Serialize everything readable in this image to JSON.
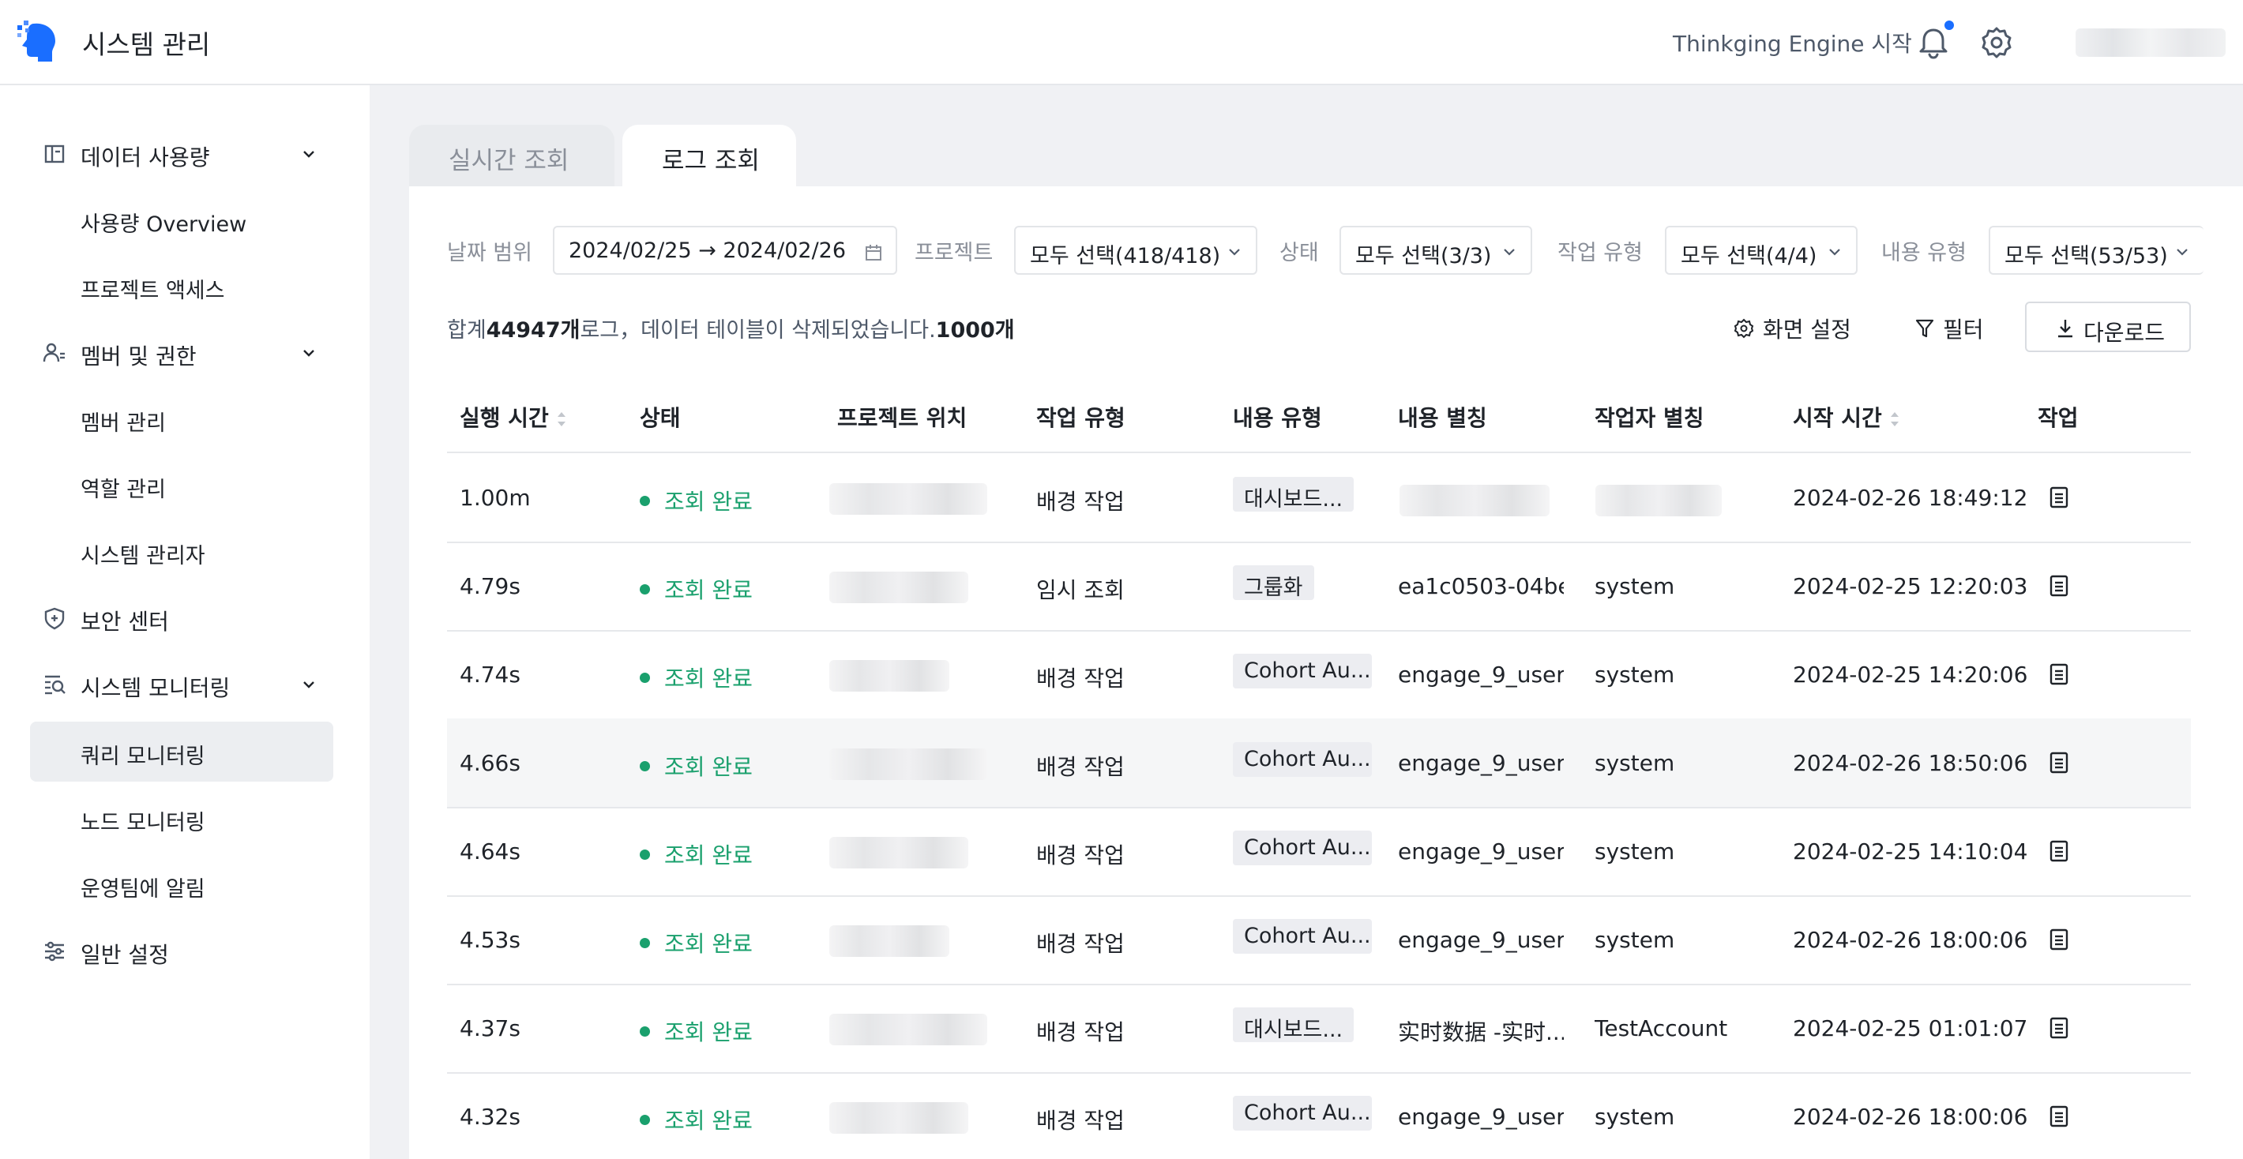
{
  "header": {
    "app_title": "시스템 관리",
    "engine_link": "Thinkging Engine 시작",
    "icons": [
      "logo-icon",
      "bell-icon",
      "gear-icon"
    ]
  },
  "sidebar": {
    "items": [
      {
        "label": "데이터 사용량",
        "icon": "chart-icon",
        "expandable": true
      },
      {
        "label": "사용량 Overview",
        "sub": true
      },
      {
        "label": "프로젝트 액세스",
        "sub": true
      },
      {
        "label": "멤버 및 권한",
        "icon": "members-icon",
        "expandable": true
      },
      {
        "label": "멤버 관리",
        "sub": true
      },
      {
        "label": "역할 관리",
        "sub": true
      },
      {
        "label": "시스템 관리자",
        "sub": true
      },
      {
        "label": "보안 센터",
        "icon": "shield-icon"
      },
      {
        "label": "시스템 모니터링",
        "icon": "monitor-icon",
        "expandable": true
      },
      {
        "label": "쿼리 모니터링",
        "sub": true,
        "active": true
      },
      {
        "label": "노드 모니터링",
        "sub": true
      },
      {
        "label": "운영팀에 알림",
        "sub": true
      },
      {
        "label": "일반 설정",
        "icon": "sliders-icon"
      }
    ]
  },
  "tabs": [
    {
      "label": "실시간 조회",
      "active": false
    },
    {
      "label": "로그 조회",
      "active": true
    }
  ],
  "filters": {
    "date_label": "날짜 범위",
    "date_value": "2024/02/25 → 2024/02/26",
    "project_label": "프로젝트",
    "project_value": "모두 선택(418/418)",
    "status_label": "상태",
    "status_value": "모두 선택(3/3)",
    "job_type_label": "작업 유형",
    "job_type_value": "모두 선택(4/4)",
    "content_type_label": "내용 유형",
    "content_type_value": "모두 선택(53/53)"
  },
  "summary": {
    "prefix": "합계",
    "total": "44947개",
    "middle": "로그，데이터 테이블이 삭제되었습니다.",
    "deleted": "1000개"
  },
  "toolbar": {
    "display_settings": "화면 설정",
    "filter": "필터",
    "download": "다운로드"
  },
  "table": {
    "columns": [
      "실행 시간",
      "상태",
      "프로젝트 위치",
      "작업 유형",
      "내용 유형",
      "내용 별칭",
      "작업자 별칭",
      "시작 시간",
      "작업"
    ],
    "rows": [
      {
        "duration": "1.00m",
        "status": "조회 완료",
        "job_type": "배경 작업",
        "content_type": "대시보드...",
        "alias": "",
        "operator": "",
        "start": "2024-02-26 18:49:12"
      },
      {
        "duration": "4.79s",
        "status": "조회 완료",
        "job_type": "임시 조회",
        "content_type": "그룹화",
        "alias": "ea1c0503-04be...",
        "operator": "system",
        "start": "2024-02-25 12:20:03"
      },
      {
        "duration": "4.74s",
        "status": "조회 완료",
        "job_type": "배경 작업",
        "content_type": "Cohort Au...",
        "alias": "engage_9_user...",
        "operator": "system",
        "start": "2024-02-25 14:20:06"
      },
      {
        "duration": "4.66s",
        "status": "조회 완료",
        "job_type": "배경 작업",
        "content_type": "Cohort Au...",
        "alias": "engage_9_user...",
        "operator": "system",
        "start": "2024-02-26 18:50:06"
      },
      {
        "duration": "4.64s",
        "status": "조회 완료",
        "job_type": "배경 작업",
        "content_type": "Cohort Au...",
        "alias": "engage_9_user...",
        "operator": "system",
        "start": "2024-02-25 14:10:04"
      },
      {
        "duration": "4.53s",
        "status": "조회 완료",
        "job_type": "배경 작업",
        "content_type": "Cohort Au...",
        "alias": "engage_9_user...",
        "operator": "system",
        "start": "2024-02-26 18:00:06"
      },
      {
        "duration": "4.37s",
        "status": "조회 완료",
        "job_type": "배경 작업",
        "content_type": "대시보드...",
        "alias": "实时数据 -实时...",
        "operator": "TestAccount",
        "start": "2024-02-25 01:01:07"
      },
      {
        "duration": "4.32s",
        "status": "조회 완료",
        "job_type": "배경 작업",
        "content_type": "Cohort Au...",
        "alias": "engage_9_user...",
        "operator": "system",
        "start": "2024-02-26 18:00:06"
      }
    ]
  },
  "colors": {
    "success": "#1aa06d",
    "accent": "#1a6eff",
    "active_nav": "#eceef1"
  }
}
